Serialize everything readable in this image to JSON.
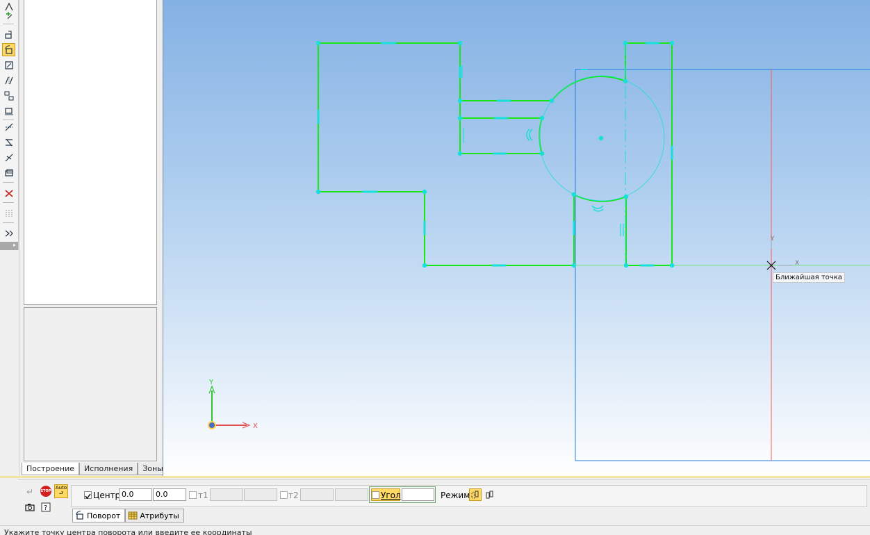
{
  "left_panel": {
    "tabs": [
      {
        "label": "Построение",
        "selected": true
      },
      {
        "label": "Исполнения",
        "selected": false
      },
      {
        "label": "Зоны",
        "selected": false
      }
    ]
  },
  "canvas": {
    "snap_hint": "Ближайшая точка",
    "local_cs": {
      "x_label": "X",
      "y_label": "Y"
    },
    "origin_cs": {
      "x_label": "X",
      "y_label": "Y"
    }
  },
  "command_panel": {
    "stop_label": "STOP",
    "auto_label": "Auto",
    "center_label": "Центр",
    "center_checked": true,
    "center_x": "0.0",
    "center_y": "0.0",
    "t1_label": "т1",
    "t2_label": "т2",
    "angle_label": "Угол",
    "angle_value": "",
    "mode_label": "Режим"
  },
  "bottom_tabs": [
    {
      "label": "Поворот",
      "selected": true
    },
    {
      "label": "Атрибуты",
      "selected": false
    }
  ],
  "status_bar": {
    "text": "Укажите точку центра поворота или введите ее координаты"
  },
  "colors": {
    "geometry": "#19e619",
    "constraint": "#17e0d8",
    "frame": "#1e7fe0",
    "guide": "#ff5a5a"
  }
}
